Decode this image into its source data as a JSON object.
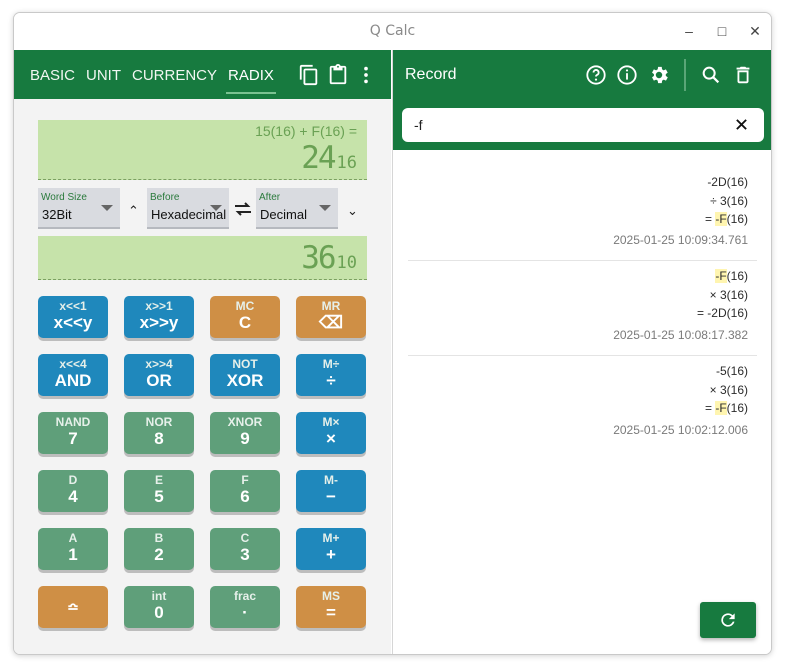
{
  "window": {
    "title": "Q Calc"
  },
  "tabs": [
    {
      "label": "BASIC"
    },
    {
      "label": "UNIT"
    },
    {
      "label": "CURRENCY"
    },
    {
      "label": "RADIX"
    }
  ],
  "display1": {
    "expression": "15(16) + F(16) =",
    "value": "24",
    "base": "16"
  },
  "word_size": {
    "label": "Word Size",
    "value": "32Bit"
  },
  "before": {
    "label": "Before",
    "value": "Hexadecimal"
  },
  "after": {
    "label": "After",
    "value": "Decimal"
  },
  "display2": {
    "value": "36",
    "base": "10"
  },
  "keys": [
    {
      "sec": "x<<1",
      "pri": "x<<y"
    },
    {
      "sec": "x>>1",
      "pri": "x>>y"
    },
    {
      "sec": "MC",
      "pri": "C"
    },
    {
      "sec": "MR",
      "pri": "⌫"
    },
    {
      "sec": "x<<4",
      "pri": "AND"
    },
    {
      "sec": "x>>4",
      "pri": "OR"
    },
    {
      "sec": "NOT",
      "pri": "XOR"
    },
    {
      "sec": "M÷",
      "pri": "÷"
    },
    {
      "sec": "NAND",
      "pri": "7"
    },
    {
      "sec": "NOR",
      "pri": "8"
    },
    {
      "sec": "XNOR",
      "pri": "9"
    },
    {
      "sec": "M×",
      "pri": "×"
    },
    {
      "sec": "D",
      "pri": "4"
    },
    {
      "sec": "E",
      "pri": "5"
    },
    {
      "sec": "F",
      "pri": "6"
    },
    {
      "sec": "M-",
      "pri": "−"
    },
    {
      "sec": "A",
      "pri": "1"
    },
    {
      "sec": "B",
      "pri": "2"
    },
    {
      "sec": "C",
      "pri": "3"
    },
    {
      "sec": "M+",
      "pri": "+"
    },
    {
      "sec": "",
      "pri": "≏"
    },
    {
      "sec": "int",
      "pri": "0"
    },
    {
      "sec": "frac",
      "pri": "·"
    },
    {
      "sec": "MS",
      "pri": "="
    }
  ],
  "record_panel": {
    "title": "Record",
    "search_value": "-f",
    "records": [
      {
        "line1_pre": "-2D(16)",
        "line1_hl": "",
        "line1_post": "",
        "line2": "÷ 3(16)",
        "line3_pre": "= ",
        "line3_hl": "-F",
        "line3_post": "(16)",
        "time": "2025-01-25 10:09:34.761"
      },
      {
        "line1_pre": "",
        "line1_hl": "-F",
        "line1_post": "(16)",
        "line2": "× 3(16)",
        "line3_pre": "= -2D(16)",
        "line3_hl": "",
        "line3_post": "",
        "time": "2025-01-25 10:08:17.382"
      },
      {
        "line1_pre": "-5(16)",
        "line1_hl": "",
        "line1_post": "",
        "line2": "× 3(16)",
        "line3_pre": "= ",
        "line3_hl": "-F",
        "line3_post": "(16)",
        "time": "2025-01-25 10:02:12.006"
      }
    ]
  },
  "colors": {
    "primary": "#177a3f",
    "display_bg": "#c6e3aa",
    "display_text": "#6aa154",
    "key_blue": "#1f88bc",
    "key_orange": "#cf8f45",
    "key_green": "#5f9f7a"
  }
}
